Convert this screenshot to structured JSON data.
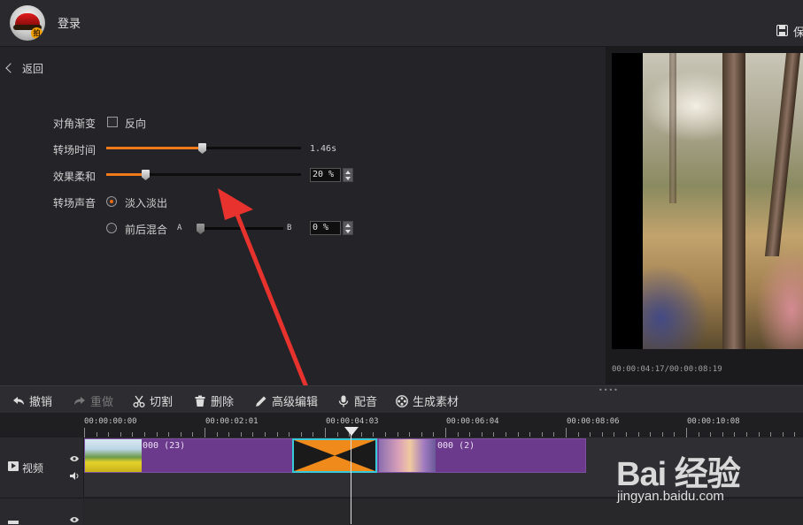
{
  "header": {
    "login": "登录",
    "save_label": "保"
  },
  "panel": {
    "back": "返回",
    "diagonal_label": "对角渐变",
    "reverse_label": "反向",
    "reverse_checked": false,
    "duration_label": "转场时间",
    "duration_value": "1.46s",
    "duration_fraction": 0.49,
    "softness_label": "效果柔和",
    "softness_value": "20 %",
    "softness_fraction": 0.2,
    "sound_label": "转场声音",
    "fade_label": "淡入淡出",
    "fade_selected": true,
    "mix_label": "前后混合",
    "mix_a": "A",
    "mix_b": "B",
    "mix_value": "0 %",
    "mix_fraction": 0.0
  },
  "preview": {
    "timecode": "00:00:04:17/00:00:08:19"
  },
  "toolbar": {
    "undo": "撤销",
    "redo": "重做",
    "cut": "切割",
    "delete": "删除",
    "advanced_edit": "高级编辑",
    "dub": "配音",
    "generate": "生成素材"
  },
  "timeline": {
    "ruler": [
      "00:00:00:00",
      "00:00:02:01",
      "00:00:04:03",
      "00:00:06:04",
      "00:00:08:06",
      "00:00:10:08"
    ],
    "track_label": "视频",
    "clip1_label": "000 (23)",
    "clip2_label": "000 (2)"
  },
  "watermark": {
    "brand": "Bai 经验",
    "url": "jingyan.baidu.com"
  },
  "colors": {
    "accent": "#f07a1a",
    "clip": "#6b3a8c",
    "transition_border": "#38c9d8",
    "annotation_arrow": "#e8322e"
  }
}
